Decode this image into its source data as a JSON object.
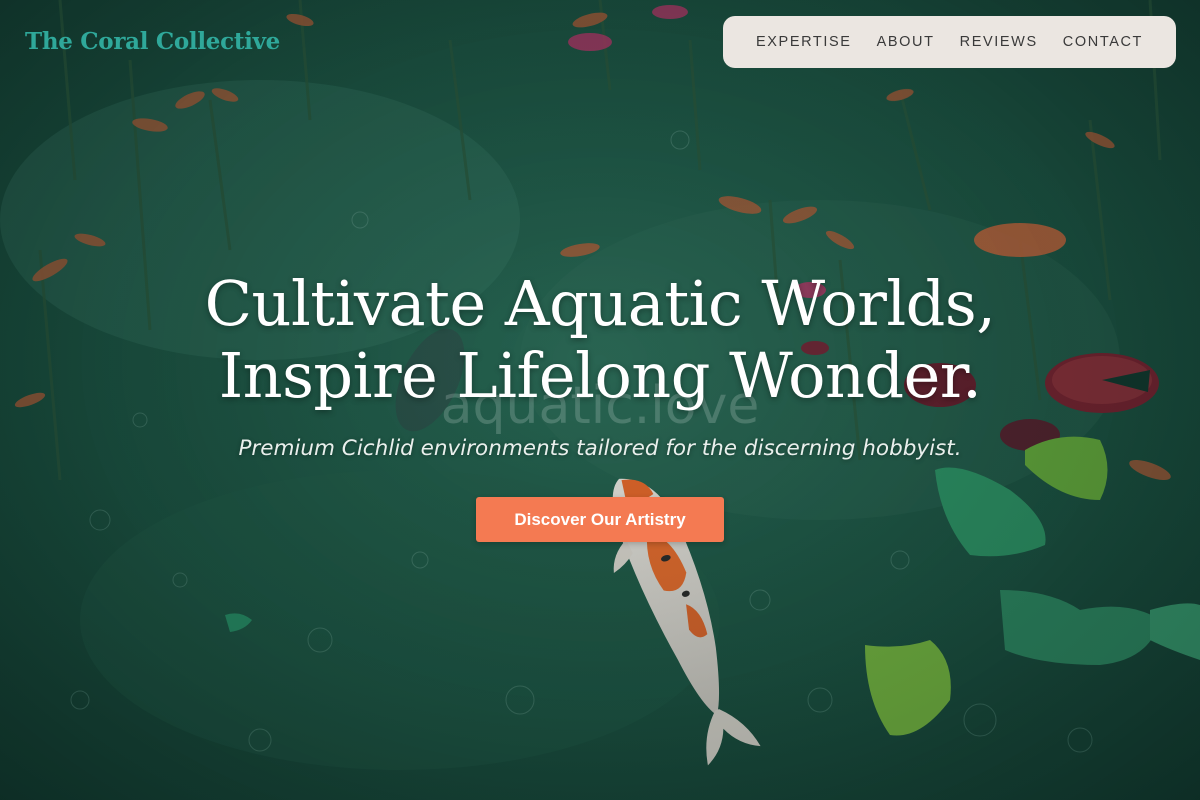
{
  "brand": {
    "name": "The Coral Collective",
    "color": "#2fa89a"
  },
  "nav": {
    "items": [
      {
        "label": "EXPERTISE"
      },
      {
        "label": "ABOUT"
      },
      {
        "label": "REVIEWS"
      },
      {
        "label": "CONTACT"
      }
    ],
    "background": "#ebe6e1"
  },
  "hero": {
    "title_line_1": "Cultivate Aquatic Worlds,",
    "title_line_2": "Inspire Lifelong Wonder.",
    "subtitle": "Premium Cichlid environments tailored for the discerning hobbyist.",
    "watermark": "aquatic.love",
    "cta_label": "Discover Our Artistry",
    "cta_color": "#f47a52"
  },
  "background": {
    "description_icon": "koi-pond-image",
    "water_color": "#1c4a3c"
  }
}
